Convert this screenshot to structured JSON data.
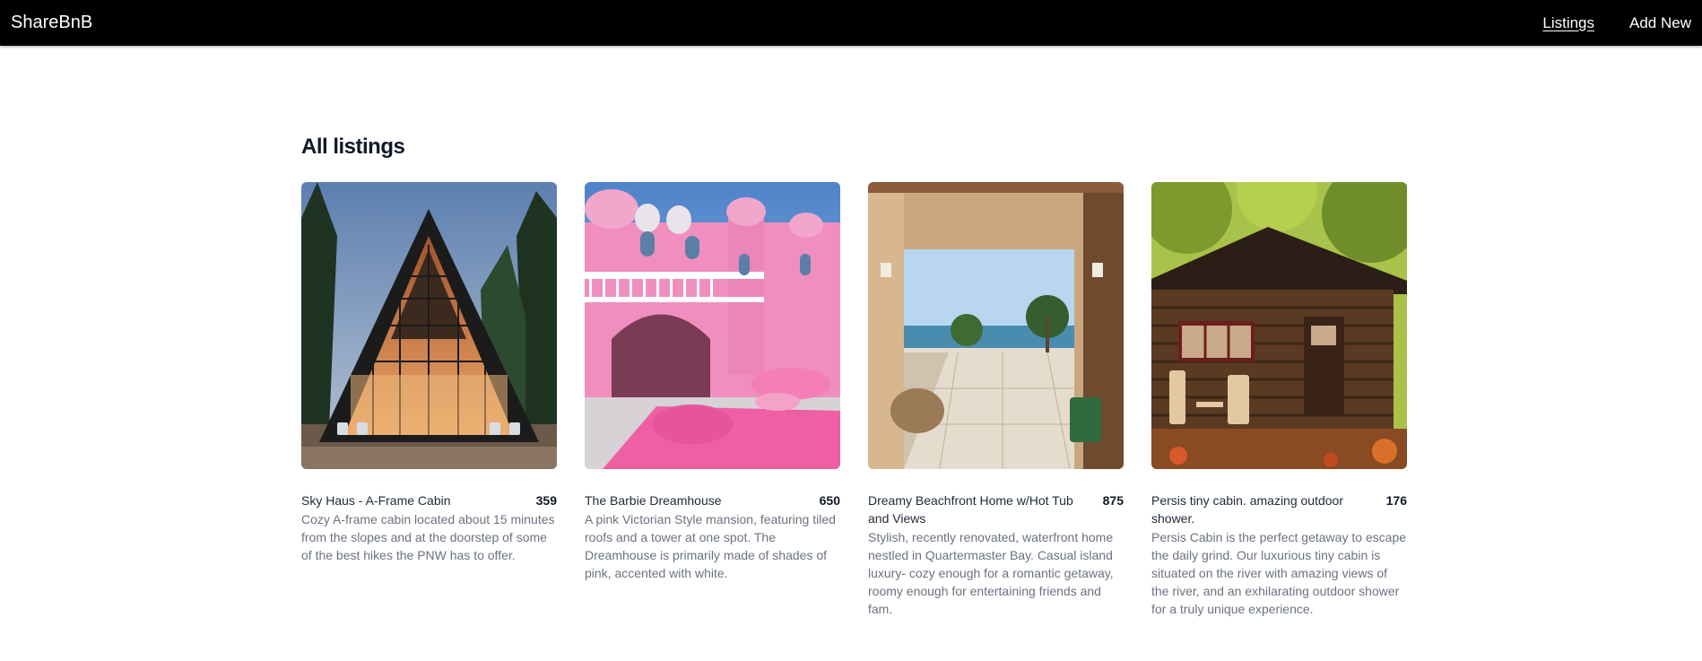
{
  "nav": {
    "brand": "ShareBnB",
    "links": [
      {
        "label": "Listings",
        "active": true
      },
      {
        "label": "Add New",
        "active": false
      }
    ]
  },
  "page": {
    "title": "All listings"
  },
  "listings": [
    {
      "title": "Sky Haus - A-Frame Cabin",
      "price": "359",
      "description": "Cozy A-frame cabin located about 15 minutes from the slopes and at the doorstep of some of the best hikes the PNW has to offer.",
      "image": "a-frame-cabin-photo"
    },
    {
      "title": "The Barbie Dreamhouse",
      "price": "650",
      "description": "A pink Victorian Style mansion, featuring tiled roofs and a tower at one spot. The Dreamhouse is primarily made of shades of pink, accented with white.",
      "image": "pink-mansion-photo"
    },
    {
      "title": "Dreamy Beachfront Home w/Hot Tub and Views",
      "price": "875",
      "description": "Stylish, recently renovated, waterfront home nestled in Quartermaster Bay. Casual island luxury- cozy enough for a romantic getaway, roomy enough for entertaining friends and fam.",
      "image": "beachfront-patio-photo"
    },
    {
      "title": "Persis tiny cabin. amazing outdoor shower.",
      "price": "176",
      "description": "Persis Cabin is the perfect getaway to escape the daily grind. Our luxurious tiny cabin is situated on the river with amazing views of the river, and an exhilarating outdoor shower for a truly unique experience.",
      "image": "log-cabin-photo"
    }
  ]
}
